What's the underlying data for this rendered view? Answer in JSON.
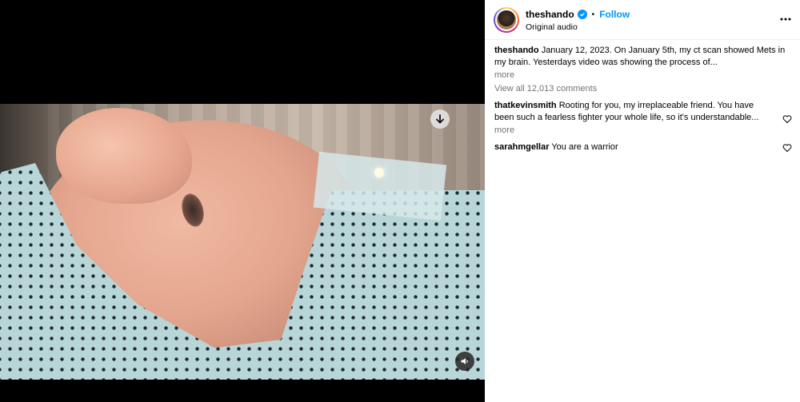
{
  "post": {
    "username": "theshando",
    "follow_label": "Follow",
    "separator": "•",
    "audio_label": "Original audio",
    "caption": "January 12, 2023. On January 5th, my ct scan showed Mets in my brain. Yesterdays video was showing the process of...",
    "more_label": "more",
    "view_all_comments": "View all 12,013 comments"
  },
  "comments": [
    {
      "username": "thatkevinsmith",
      "text": "Rooting for you, my irreplaceable friend. You have been such a fearless fighter your whole life, so it's understandable...",
      "more_label": "more"
    },
    {
      "username": "sarahmgellar",
      "text": "You are a warrior"
    }
  ],
  "icons": {
    "download": "download-arrow-icon",
    "audio": "speaker-icon",
    "verified": "verified-badge-icon",
    "options": "more-options-icon",
    "like": "heart-icon"
  },
  "colors": {
    "accent": "#0095f6",
    "secondary_text": "#737373"
  }
}
